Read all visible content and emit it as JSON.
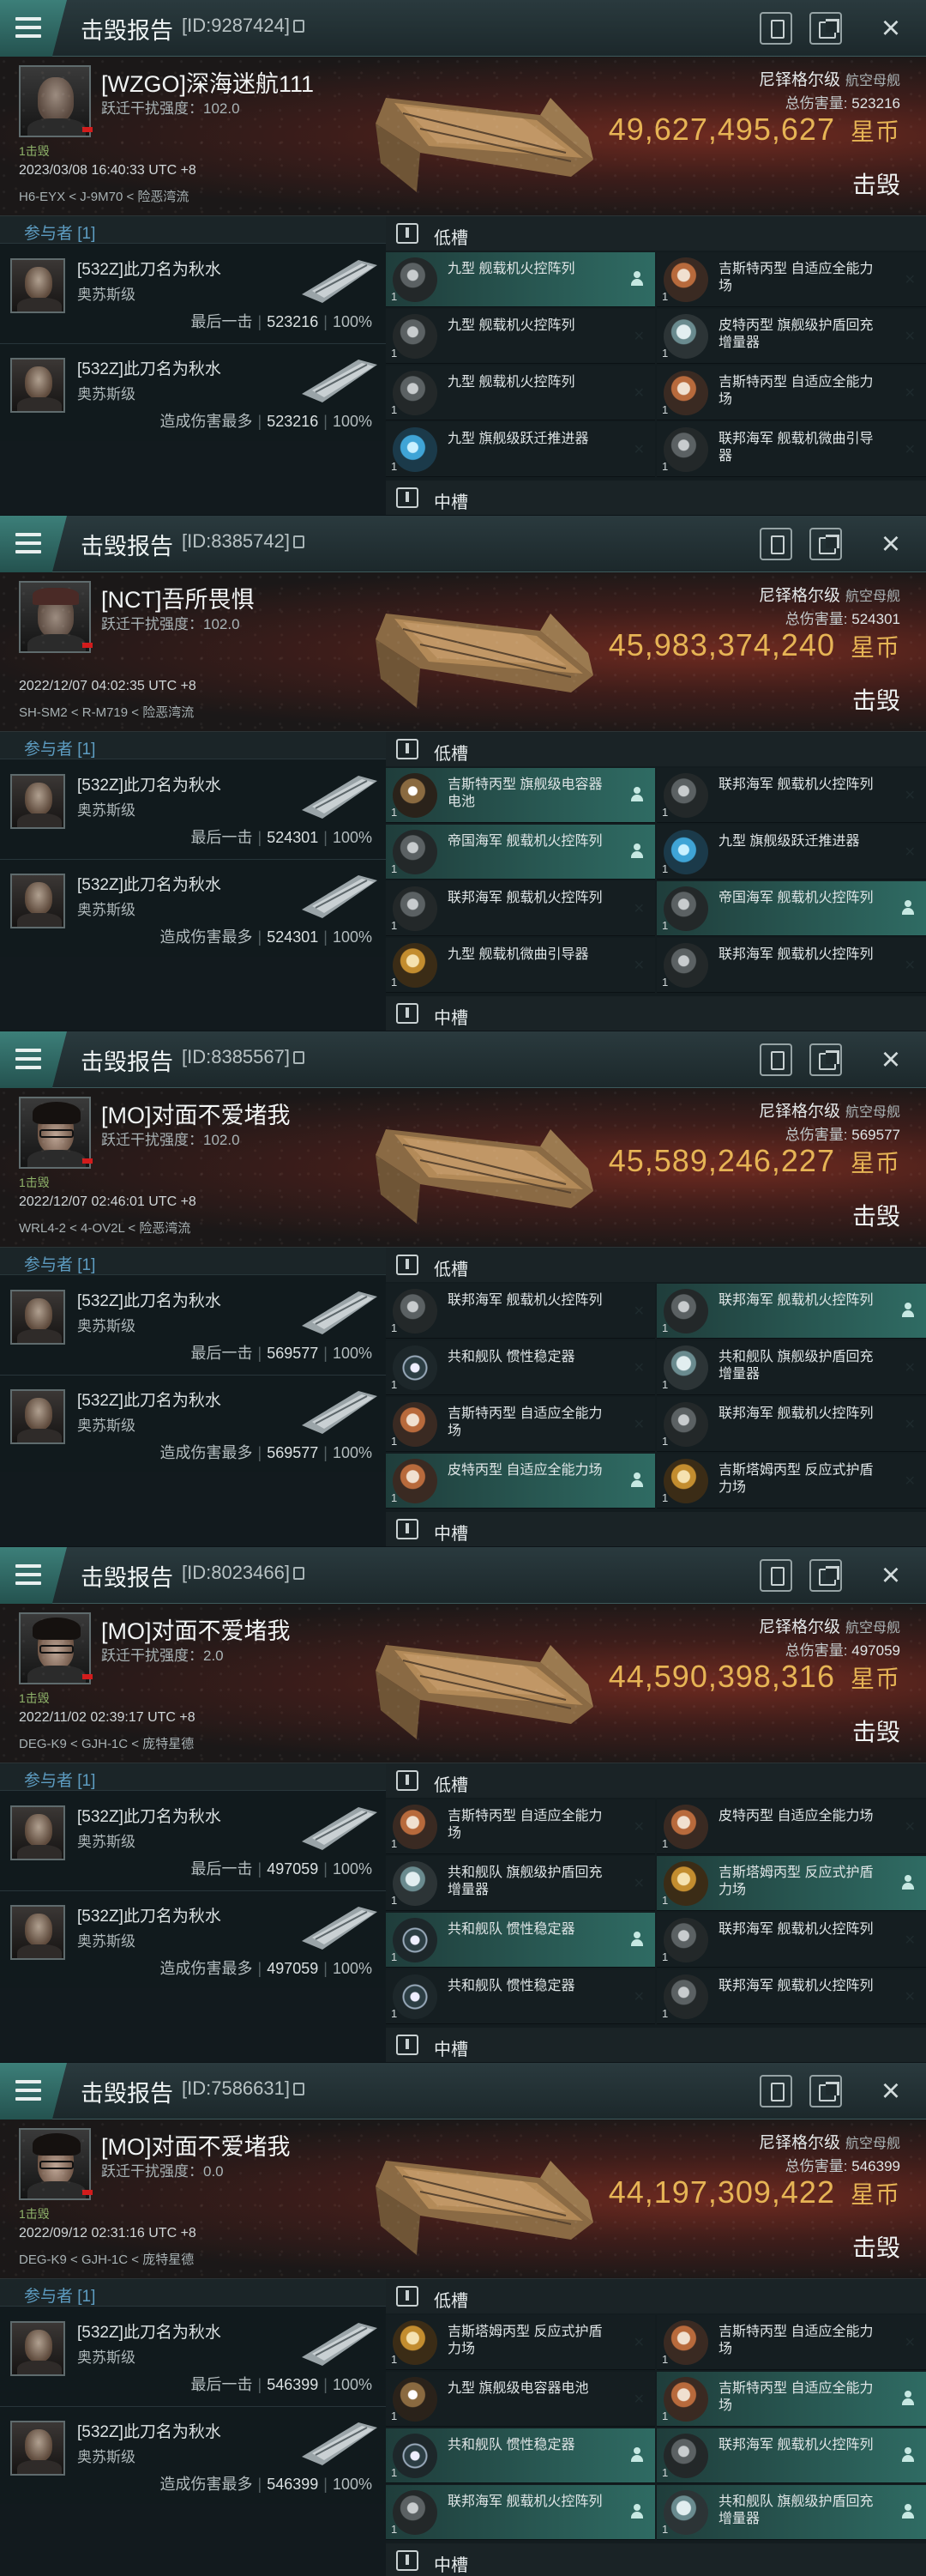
{
  "reports": [
    {
      "title": "击毁报告",
      "report_id": "[ID:9287424]",
      "victim": {
        "name": "[WZGO]深海迷航111",
        "jam": "跃迁干扰强度：102.0",
        "strike": "1击毁",
        "datetime": "2023/03/08 16:40:33 UTC +8",
        "location": "H6-EYX < J-9M70 < 险恶湾流",
        "portrait": "bald"
      },
      "ship": {
        "name": "尼铎格尔级",
        "class": "航空母舰",
        "damage_label": "总伤害量:",
        "damage": "523216",
        "isk": "49,627,495,627",
        "isk_unit": "星币",
        "result": "击毁"
      },
      "participants_label": "参与者 [1]",
      "participants": [
        {
          "name": "[532Z]此刀名为秋水",
          "ship": "奥苏斯级",
          "stat_label": "最后一击",
          "damage": "523216",
          "pct": "100%"
        },
        {
          "name": "[532Z]此刀名为秋水",
          "ship": "奥苏斯级",
          "stat_label": "造成伤害最多",
          "damage": "523216",
          "pct": "100%"
        }
      ],
      "low_label": "低槽",
      "mid_label": "中槽",
      "modules": [
        {
          "name": "九型 舰载机火控阵列",
          "qty": "1",
          "icon": "grey",
          "hl": true
        },
        {
          "name": "吉斯特丙型 自适应全能力场",
          "qty": "1",
          "icon": "hard",
          "hl": false
        },
        {
          "name": "九型 舰载机火控阵列",
          "qty": "1",
          "icon": "grey",
          "hl": false
        },
        {
          "name": "皮特丙型 旗舰级护盾回充增量器",
          "qty": "1",
          "icon": "shield",
          "hl": false
        },
        {
          "name": "九型 舰载机火控阵列",
          "qty": "1",
          "icon": "grey",
          "hl": false
        },
        {
          "name": "吉斯特丙型 自适应全能力场",
          "qty": "1",
          "icon": "hard",
          "hl": false
        },
        {
          "name": "九型 旗舰级跃迁推进器",
          "qty": "1",
          "icon": "jump",
          "hl": false
        },
        {
          "name": "联邦海军 舰载机微曲引导器",
          "qty": "1",
          "icon": "grey",
          "hl": false
        }
      ]
    },
    {
      "title": "击毁报告",
      "report_id": "[ID:8385742]",
      "victim": {
        "name": "[NCT]吾所畏惧",
        "jam": "跃迁干扰强度：102.0",
        "strike": "",
        "datetime": "2022/12/07 04:02:35 UTC +8",
        "location": "SH-SM2 < R-M719 < 险恶湾流",
        "portrait": "cap"
      },
      "ship": {
        "name": "尼铎格尔级",
        "class": "航空母舰",
        "damage_label": "总伤害量:",
        "damage": "524301",
        "isk": "45,983,374,240",
        "isk_unit": "星币",
        "result": "击毁"
      },
      "participants_label": "参与者 [1]",
      "participants": [
        {
          "name": "[532Z]此刀名为秋水",
          "ship": "奥苏斯级",
          "stat_label": "最后一击",
          "damage": "524301",
          "pct": "100%"
        },
        {
          "name": "[532Z]此刀名为秋水",
          "ship": "奥苏斯级",
          "stat_label": "造成伤害最多",
          "damage": "524301",
          "pct": "100%"
        }
      ],
      "low_label": "低槽",
      "mid_label": "中槽",
      "modules": [
        {
          "name": "吉斯特丙型 旗舰级电容器电池",
          "qty": "1",
          "icon": "cap",
          "hl": true
        },
        {
          "name": "联邦海军 舰载机火控阵列",
          "qty": "1",
          "icon": "grey",
          "hl": false
        },
        {
          "name": "帝国海军 舰载机火控阵列",
          "qty": "1",
          "icon": "grey",
          "hl": true
        },
        {
          "name": "九型 旗舰级跃迁推进器",
          "qty": "1",
          "icon": "jump",
          "hl": false
        },
        {
          "name": "联邦海军 舰载机火控阵列",
          "qty": "1",
          "icon": "grey",
          "hl": false
        },
        {
          "name": "帝国海军 舰载机火控阵列",
          "qty": "1",
          "icon": "grey",
          "hl": true
        },
        {
          "name": "九型 舰载机微曲引导器",
          "qty": "1",
          "icon": "gold",
          "hl": false
        },
        {
          "name": "联邦海军 舰载机火控阵列",
          "qty": "1",
          "icon": "grey",
          "hl": false
        }
      ]
    },
    {
      "title": "击毁报告",
      "report_id": "[ID:8385567]",
      "victim": {
        "name": "[MO]对面不爱堵我",
        "jam": "跃迁干扰强度：102.0",
        "strike": "1击毁",
        "datetime": "2022/12/07 02:46:01 UTC +8",
        "location": "WRL4-2 < 4-OV2L < 险恶湾流",
        "portrait": "glasses"
      },
      "ship": {
        "name": "尼铎格尔级",
        "class": "航空母舰",
        "damage_label": "总伤害量:",
        "damage": "569577",
        "isk": "45,589,246,227",
        "isk_unit": "星币",
        "result": "击毁"
      },
      "participants_label": "参与者 [1]",
      "participants": [
        {
          "name": "[532Z]此刀名为秋水",
          "ship": "奥苏斯级",
          "stat_label": "最后一击",
          "damage": "569577",
          "pct": "100%"
        },
        {
          "name": "[532Z]此刀名为秋水",
          "ship": "奥苏斯级",
          "stat_label": "造成伤害最多",
          "damage": "569577",
          "pct": "100%"
        }
      ],
      "low_label": "低槽",
      "mid_label": "中槽",
      "modules": [
        {
          "name": "联邦海军 舰载机火控阵列",
          "qty": "1",
          "icon": "grey",
          "hl": false
        },
        {
          "name": "联邦海军 舰载机火控阵列",
          "qty": "1",
          "icon": "grey",
          "hl": true
        },
        {
          "name": "共和舰队 惯性稳定器",
          "qty": "1",
          "icon": "stab",
          "hl": false
        },
        {
          "name": "共和舰队 旗舰级护盾回充增量器",
          "qty": "1",
          "icon": "shield",
          "hl": false
        },
        {
          "name": "吉斯特丙型 自适应全能力场",
          "qty": "1",
          "icon": "hard",
          "hl": false
        },
        {
          "name": "联邦海军 舰载机火控阵列",
          "qty": "1",
          "icon": "grey",
          "hl": false
        },
        {
          "name": "皮特丙型 自适应全能力场",
          "qty": "1",
          "icon": "hard",
          "hl": true
        },
        {
          "name": "吉斯塔姆丙型 反应式护盾力场",
          "qty": "1",
          "icon": "gold",
          "hl": false
        }
      ]
    },
    {
      "title": "击毁报告",
      "report_id": "[ID:8023466]",
      "victim": {
        "name": "[MO]对面不爱堵我",
        "jam": "跃迁干扰强度：2.0",
        "strike": "1击毁",
        "datetime": "2022/11/02 02:39:17 UTC +8",
        "location": "DEG-K9 < GJH-1C < 庞特星德",
        "portrait": "glasses"
      },
      "ship": {
        "name": "尼铎格尔级",
        "class": "航空母舰",
        "damage_label": "总伤害量:",
        "damage": "497059",
        "isk": "44,590,398,316",
        "isk_unit": "星币",
        "result": "击毁"
      },
      "participants_label": "参与者 [1]",
      "participants": [
        {
          "name": "[532Z]此刀名为秋水",
          "ship": "奥苏斯级",
          "stat_label": "最后一击",
          "damage": "497059",
          "pct": "100%"
        },
        {
          "name": "[532Z]此刀名为秋水",
          "ship": "奥苏斯级",
          "stat_label": "造成伤害最多",
          "damage": "497059",
          "pct": "100%"
        }
      ],
      "low_label": "低槽",
      "mid_label": "中槽",
      "modules": [
        {
          "name": "吉斯特丙型 自适应全能力场",
          "qty": "1",
          "icon": "hard",
          "hl": false
        },
        {
          "name": "皮特丙型 自适应全能力场",
          "qty": "1",
          "icon": "hard",
          "hl": false
        },
        {
          "name": "共和舰队 旗舰级护盾回充增量器",
          "qty": "1",
          "icon": "shield",
          "hl": false
        },
        {
          "name": "吉斯塔姆丙型 反应式护盾力场",
          "qty": "1",
          "icon": "gold",
          "hl": true
        },
        {
          "name": "共和舰队 惯性稳定器",
          "qty": "1",
          "icon": "stab",
          "hl": true
        },
        {
          "name": "联邦海军 舰载机火控阵列",
          "qty": "1",
          "icon": "grey",
          "hl": false
        },
        {
          "name": "共和舰队 惯性稳定器",
          "qty": "1",
          "icon": "stab",
          "hl": false
        },
        {
          "name": "联邦海军 舰载机火控阵列",
          "qty": "1",
          "icon": "grey",
          "hl": false
        }
      ]
    },
    {
      "title": "击毁报告",
      "report_id": "[ID:7586631]",
      "victim": {
        "name": "[MO]对面不爱堵我",
        "jam": "跃迁干扰强度：0.0",
        "strike": "1击毁",
        "datetime": "2022/09/12 02:31:16 UTC +8",
        "location": "DEG-K9 < GJH-1C < 庞特星德",
        "portrait": "glasses"
      },
      "ship": {
        "name": "尼铎格尔级",
        "class": "航空母舰",
        "damage_label": "总伤害量:",
        "damage": "546399",
        "isk": "44,197,309,422",
        "isk_unit": "星币",
        "result": "击毁"
      },
      "participants_label": "参与者 [1]",
      "participants": [
        {
          "name": "[532Z]此刀名为秋水",
          "ship": "奥苏斯级",
          "stat_label": "最后一击",
          "damage": "546399",
          "pct": "100%"
        },
        {
          "name": "[532Z]此刀名为秋水",
          "ship": "奥苏斯级",
          "stat_label": "造成伤害最多",
          "damage": "546399",
          "pct": "100%"
        }
      ],
      "low_label": "低槽",
      "mid_label": "中槽",
      "modules": [
        {
          "name": "吉斯塔姆丙型 反应式护盾力场",
          "qty": "1",
          "icon": "gold",
          "hl": false
        },
        {
          "name": "吉斯特丙型 自适应全能力场",
          "qty": "1",
          "icon": "hard",
          "hl": false
        },
        {
          "name": "九型 旗舰级电容器电池",
          "qty": "1",
          "icon": "cap",
          "hl": false
        },
        {
          "name": "吉斯特丙型 自适应全能力场",
          "qty": "1",
          "icon": "hard",
          "hl": true
        },
        {
          "name": "共和舰队 惯性稳定器",
          "qty": "1",
          "icon": "stab",
          "hl": true
        },
        {
          "name": "联邦海军 舰载机火控阵列",
          "qty": "1",
          "icon": "grey",
          "hl": true
        },
        {
          "name": "联邦海军 舰载机火控阵列",
          "qty": "1",
          "icon": "grey",
          "hl": true
        },
        {
          "name": "共和舰队 旗舰级护盾回充增量器",
          "qty": "1",
          "icon": "shield",
          "hl": true
        }
      ]
    }
  ]
}
